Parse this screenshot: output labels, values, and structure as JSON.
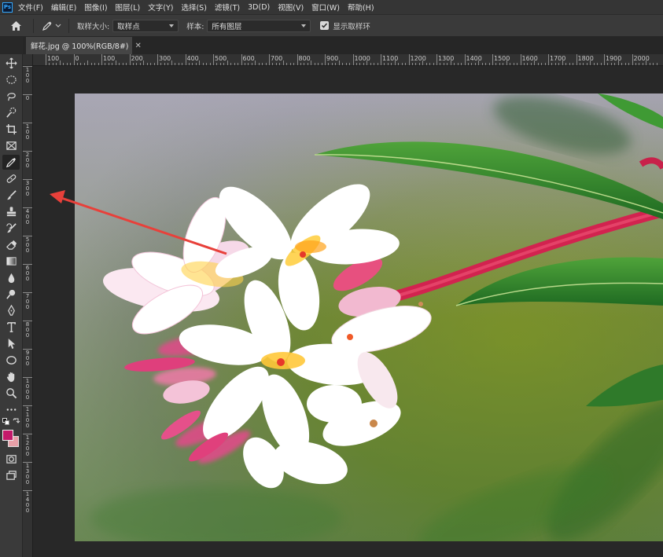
{
  "app": {
    "logo": "Ps"
  },
  "menu": [
    "文件(F)",
    "编辑(E)",
    "图像(I)",
    "图层(L)",
    "文字(Y)",
    "选择(S)",
    "滤镜(T)",
    "3D(D)",
    "视图(V)",
    "窗口(W)",
    "帮助(H)"
  ],
  "options": {
    "sample_size_label": "取样大小:",
    "sample_size_value": "取样点",
    "sample_label": "样本:",
    "sample_value": "所有图层",
    "show_ring_label": "显示取样环",
    "show_ring_checked": true
  },
  "document_tab": {
    "title": "鲜花.jpg @ 100%(RGB/8#)",
    "close": "✕"
  },
  "ruler": {
    "h_ticks": [
      "100",
      "0",
      "100",
      "200",
      "300",
      "400",
      "500",
      "600",
      "700",
      "800",
      "900",
      "1000",
      "1100",
      "1200",
      "1300",
      "1400",
      "1500",
      "1600",
      "1700",
      "1800",
      "1900",
      "2000"
    ],
    "v_ticks": [
      "100",
      "0",
      "100",
      "200",
      "300",
      "400",
      "500",
      "600",
      "700",
      "800",
      "900",
      "1000",
      "1100",
      "1200",
      "1300",
      "1400"
    ]
  },
  "toolbar": {
    "tools": [
      "move-icon",
      "marquee-icon",
      "lasso-icon",
      "quick-select-icon",
      "crop-icon",
      "frame-icon",
      "eyedropper-icon",
      "healing-icon",
      "brush-icon",
      "stamp-icon",
      "history-brush-icon",
      "eraser-icon",
      "gradient-icon",
      "blur-icon",
      "dodge-icon",
      "pen-icon",
      "type-icon",
      "path-select-icon",
      "shape-icon",
      "hand-icon",
      "zoom-icon",
      "more-icon"
    ],
    "active_tool": "eyedropper-icon",
    "foreground_color": "#c4196a",
    "background_color": "#e8a0a8"
  },
  "colors": {
    "accent": "#31a8ff",
    "arrow": "#e8403a"
  }
}
